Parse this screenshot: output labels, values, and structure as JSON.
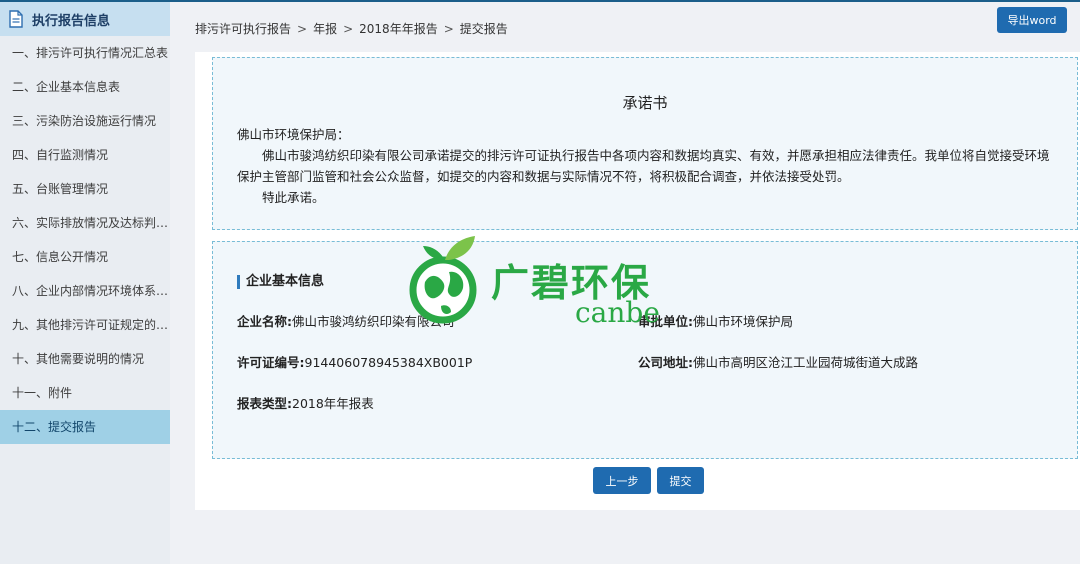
{
  "sidebar": {
    "title": "执行报告信息",
    "items": [
      {
        "label": "一、排污许可执行情况汇总表"
      },
      {
        "label": "二、企业基本信息表"
      },
      {
        "label": "三、污染防治设施运行情况"
      },
      {
        "label": "四、自行监测情况"
      },
      {
        "label": "五、台账管理情况"
      },
      {
        "label": "六、实际排放情况及达标判定分析"
      },
      {
        "label": "七、信息公开情况"
      },
      {
        "label": "八、企业内部情况环境体系建设与运行情况"
      },
      {
        "label": "九、其他排污许可证规定的内容执行情况"
      },
      {
        "label": "十、其他需要说明的情况"
      },
      {
        "label": "十一、附件"
      },
      {
        "label": "十二、提交报告"
      }
    ]
  },
  "breadcrumb": [
    "排污许可执行报告",
    "年报",
    "2018年年报告",
    "提交报告"
  ],
  "toolbar": {
    "export_label": "导出word"
  },
  "pledge": {
    "title": "承诺书",
    "addressee": "佛山市环境保护局：",
    "paragraph": "佛山市骏鸿纺织印染有限公司承诺提交的排污许可证执行报告中各项内容和数据均真实、有效，并愿承担相应法律责任。我单位将自觉接受环境保护主管部门监管和社会公众监督，如提交的内容和数据与实际情况不符，将积极配合调查，并依法接受处罚。",
    "closing": "特此承诺。"
  },
  "company": {
    "section_title": "企业基本信息",
    "name_label": "企业名称:",
    "name_value": "佛山市骏鸿纺织印染有限公司",
    "approver_label": "审批单位:",
    "approver_value": "佛山市环境保护局",
    "license_label": "许可证编号:",
    "license_value": "914406078945384XB001P",
    "address_label": "公司地址:",
    "address_value": "佛山市高明区沧江工业园荷城街道大成路",
    "type_label": "报表类型:",
    "type_value": "2018年年报表"
  },
  "actions": {
    "prev_label": "上一步",
    "submit_label": "提交"
  },
  "watermark": {
    "cn": "广碧环保",
    "en": "canbe"
  },
  "colors": {
    "primary": "#1f6bb0",
    "sidebar_active": "#9fd0e6",
    "watermark": "#2aa845"
  }
}
